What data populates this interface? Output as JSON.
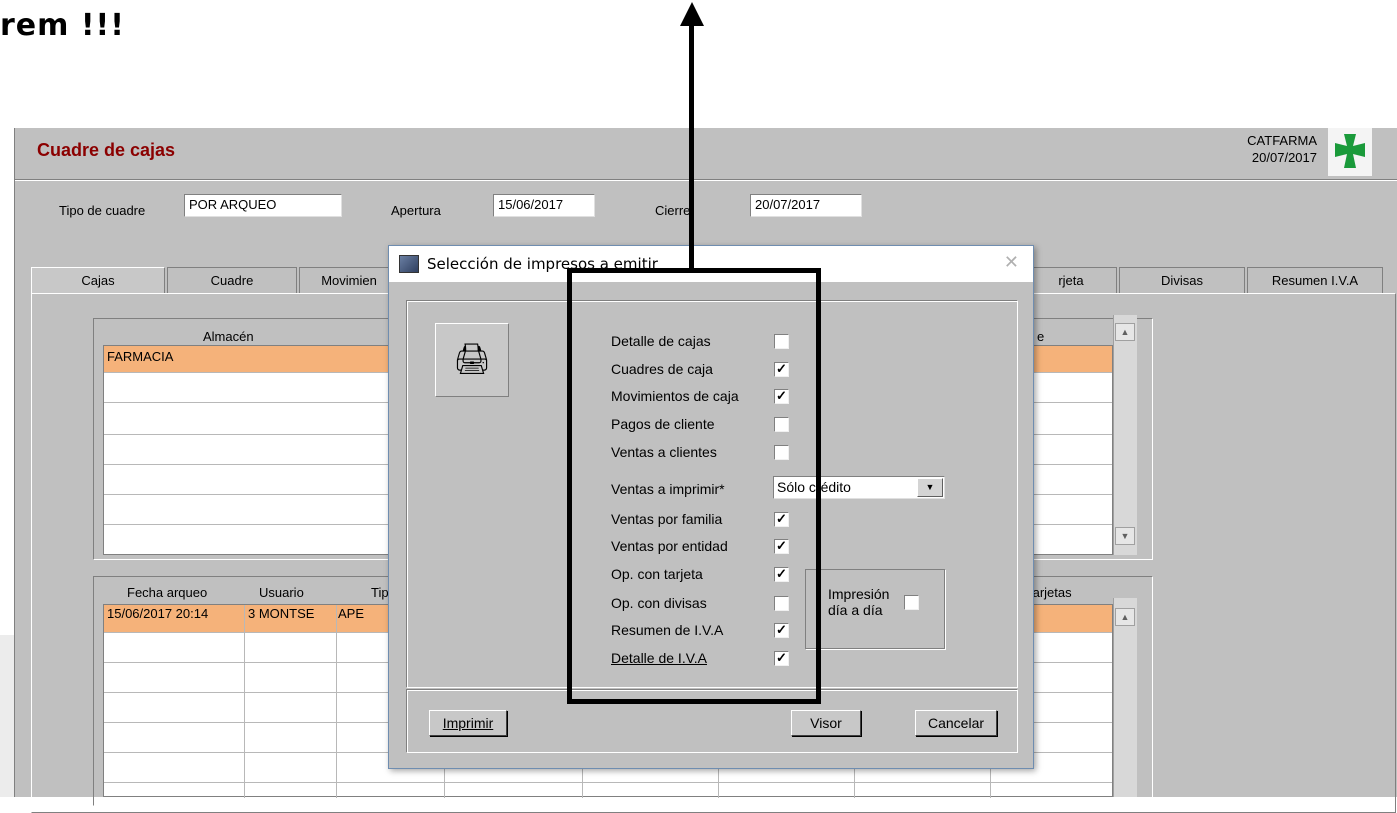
{
  "caption": "rem !!!",
  "window": {
    "title": "Cuadre de cajas",
    "brand": "CATFARMA",
    "date": "20/07/2017",
    "tipo_label": "Tipo de cuadre",
    "tipo_value": "POR ARQUEO",
    "apertura_label": "Apertura",
    "apertura_value": "15/06/2017",
    "cierre_label": "Cierre",
    "cierre_value": "20/07/2017"
  },
  "tabs": [
    "Cajas",
    "Cuadre",
    "Movimien",
    "rjeta",
    "Divisas",
    "Resumen I.V.A"
  ],
  "grid1": {
    "header_almacen": "Almacén",
    "header_right": "e",
    "row1": "FARMACIA"
  },
  "grid2": {
    "h_fecha": "Fecha arqueo",
    "h_usuario": "Usuario",
    "h_tipo": "Tip",
    "h_tarjetas": "tarjetas",
    "row_fecha": "15/06/2017 20:14",
    "row_usuario": "3 MONTSE",
    "row_tipo": "APE"
  },
  "dialog": {
    "title": "Selección de impresos a emitir",
    "close": "✕",
    "options": [
      {
        "label": "Detalle de cajas",
        "checked": false
      },
      {
        "label": "Cuadres de caja",
        "checked": true
      },
      {
        "label": "Movimientos de caja",
        "checked": true
      },
      {
        "label": "Pagos de cliente",
        "checked": false
      },
      {
        "label": "Ventas a clientes",
        "checked": false
      },
      {
        "label": "Ventas a imprimir*",
        "checked": null
      },
      {
        "label": "Ventas por familia",
        "checked": true
      },
      {
        "label": "Ventas por entidad",
        "checked": true
      },
      {
        "label": "Op. con tarjeta",
        "checked": true
      },
      {
        "label": "Op. con divisas",
        "checked": false
      },
      {
        "label": "Resumen de I.V.A",
        "checked": true
      },
      {
        "label": "Detalle de I.V.A",
        "checked": true
      }
    ],
    "ventas_select": "Sólo crédito",
    "impresion_label_1": "Impresión",
    "impresion_label_2": "día a día",
    "impresion_checked": false,
    "btn_imprimir": "Imprimir",
    "btn_visor": "Visor",
    "btn_cancelar": "Cancelar"
  },
  "icons": {
    "printer": "printer-icon",
    "cross": "green-cross-logo",
    "arrow": "arrow-up-annotation"
  },
  "colors": {
    "title_red": "#8b0000",
    "selected_row": "#f5b27a",
    "cross_green": "#1a9a3a"
  }
}
